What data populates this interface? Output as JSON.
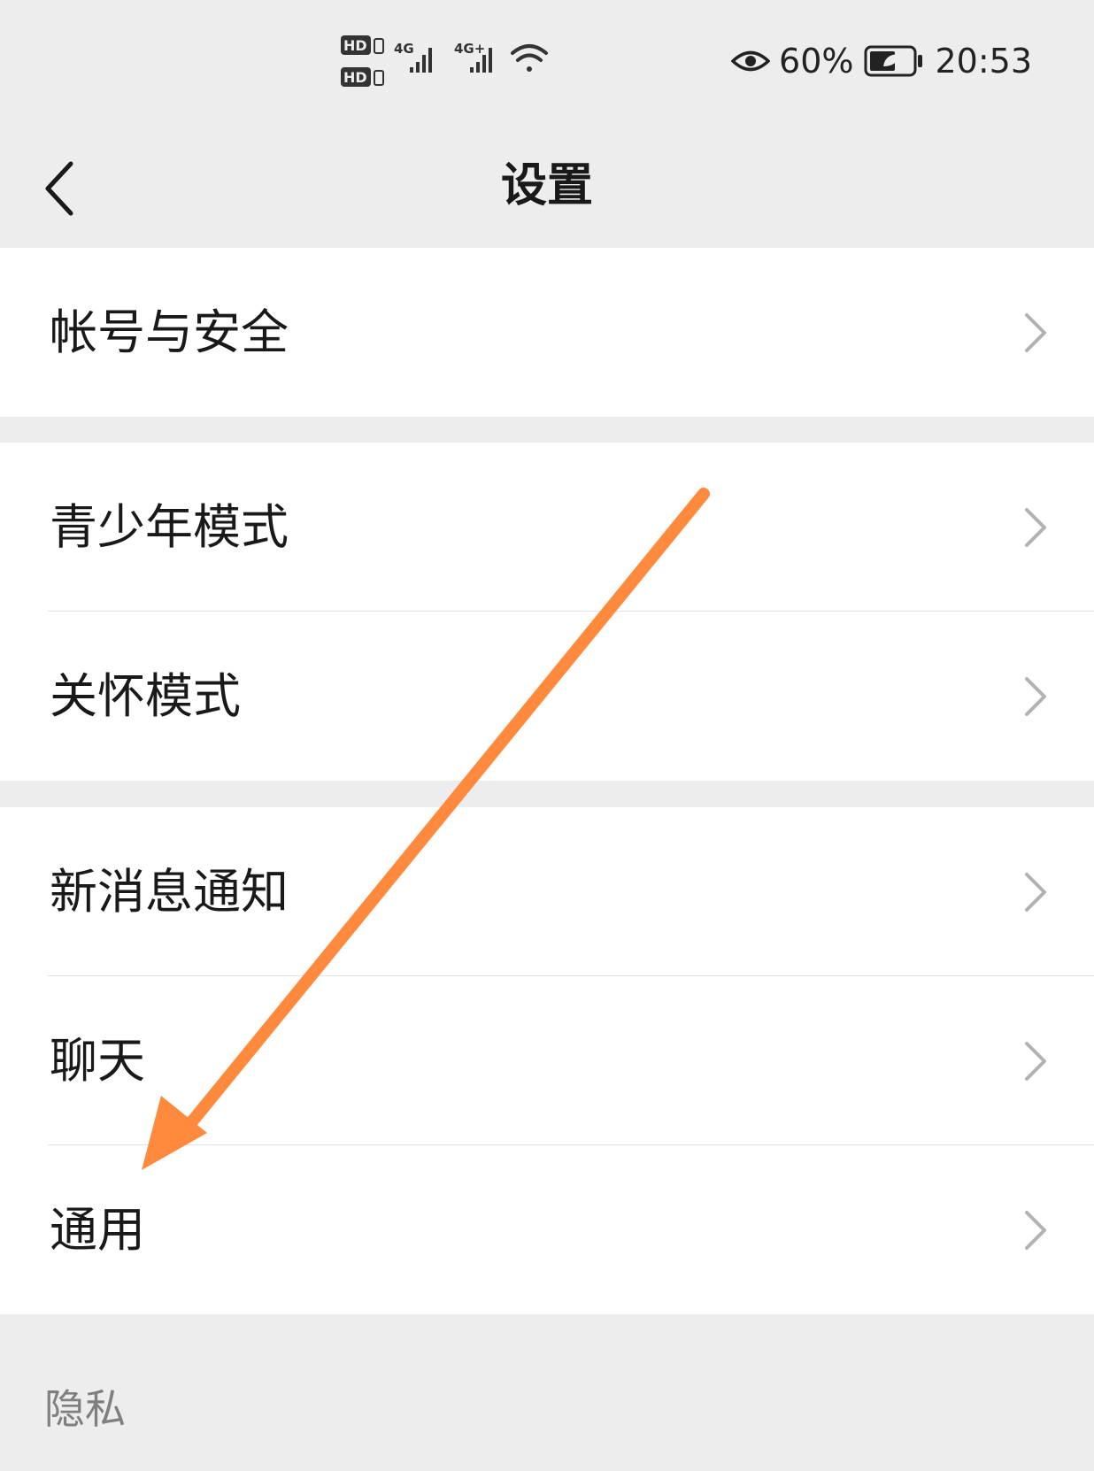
{
  "status_bar": {
    "battery_percent": "60%",
    "time": "20:53",
    "icons": [
      "hd1-icon",
      "hd2-icon",
      "signal-4g-icon",
      "signal-4g-plus-icon",
      "wifi-icon",
      "eye-icon",
      "battery-icon"
    ]
  },
  "header": {
    "title": "设置",
    "back_icon": "chevron-left-icon"
  },
  "groups": [
    {
      "items": [
        {
          "label": "帐号与安全"
        }
      ]
    },
    {
      "items": [
        {
          "label": "青少年模式"
        },
        {
          "label": "关怀模式"
        }
      ]
    },
    {
      "items": [
        {
          "label": "新消息通知"
        },
        {
          "label": "聊天"
        },
        {
          "label": "通用"
        }
      ]
    }
  ],
  "section": {
    "privacy_header": "隐私"
  },
  "annotation": {
    "arrow_color": "#ff8a3d"
  },
  "colors": {
    "background": "#ededed",
    "row_bg": "#ffffff",
    "text": "#191919",
    "chevron": "#b2b2b2"
  }
}
